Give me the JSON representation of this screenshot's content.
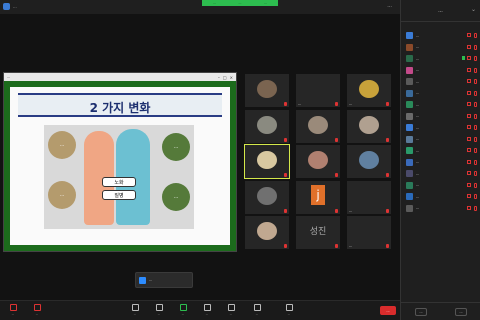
{
  "window": {
    "title": "...",
    "view_label": "..."
  },
  "share_banner": {
    "items": [
      "...",
      "...",
      "..."
    ]
  },
  "shared_window": {
    "title": "..."
  },
  "slide": {
    "title": "2 가지 변화",
    "bubbles": [
      "...",
      "...",
      "...",
      "..."
    ],
    "labels": [
      "노화",
      "질병"
    ],
    "colors": {
      "frame": "#1c6b1c",
      "title": "#1d2f6f",
      "bubble_tan": "#b49b6d",
      "bubble_olive": "#557a3a"
    }
  },
  "participant_tiles": [
    {
      "name": "",
      "type": "camera",
      "color": "#7a6450"
    },
    {
      "name": "...",
      "type": "blank"
    },
    {
      "name": "...",
      "type": "camera",
      "color": "#c8a23a"
    },
    {
      "name": "",
      "type": "camera",
      "color": "#8a8a80"
    },
    {
      "name": "",
      "type": "camera",
      "color": "#9a8a7a"
    },
    {
      "name": "",
      "type": "camera",
      "color": "#b0a090"
    },
    {
      "name": "",
      "type": "camera",
      "color": "#d8c8a0",
      "active": true
    },
    {
      "name": "",
      "type": "camera",
      "color": "#b08070"
    },
    {
      "name": "",
      "type": "camera",
      "color": "#6080a0"
    },
    {
      "name": "",
      "type": "camera",
      "color": "#707070"
    },
    {
      "name": "",
      "type": "initial",
      "initial": "j",
      "color": "#e0702a"
    },
    {
      "name": "...",
      "type": "blank"
    },
    {
      "name": "",
      "type": "camera",
      "color": "#c0a890"
    },
    {
      "name": "",
      "type": "text",
      "text": "성진"
    },
    {
      "name": "...",
      "type": "blank"
    }
  ],
  "notification": {
    "text": "..."
  },
  "toolbar": {
    "buttons": [
      "...",
      "...",
      "...",
      "...",
      "...",
      "...",
      "...",
      "...",
      "..."
    ],
    "end_label": "..."
  },
  "panel": {
    "title": "...",
    "participants": [
      {
        "name": "...",
        "color": "#3a7bd5"
      },
      {
        "name": "...",
        "color": "#8a4a2a"
      },
      {
        "name": "...",
        "color": "#2a6a4a",
        "sharing": true
      },
      {
        "name": "...",
        "color": "#c44a8a"
      },
      {
        "name": "...",
        "color": "#5a5a5a"
      },
      {
        "name": "...",
        "color": "#3a6a9a"
      },
      {
        "name": "...",
        "color": "#2a8a5a"
      },
      {
        "name": "...",
        "color": "#6a6a6a"
      },
      {
        "name": "...",
        "color": "#3a7bd5"
      },
      {
        "name": "...",
        "color": "#5a7a9a"
      },
      {
        "name": "...",
        "color": "#2a9a6a"
      },
      {
        "name": "...",
        "color": "#3a6aba"
      },
      {
        "name": "...",
        "color": "#4a4a6a"
      },
      {
        "name": "...",
        "color": "#2a7a5a"
      },
      {
        "name": "...",
        "color": "#2a6aba"
      },
      {
        "name": "...",
        "color": "#5a5a5a"
      }
    ],
    "footer": [
      "...",
      "..."
    ]
  }
}
